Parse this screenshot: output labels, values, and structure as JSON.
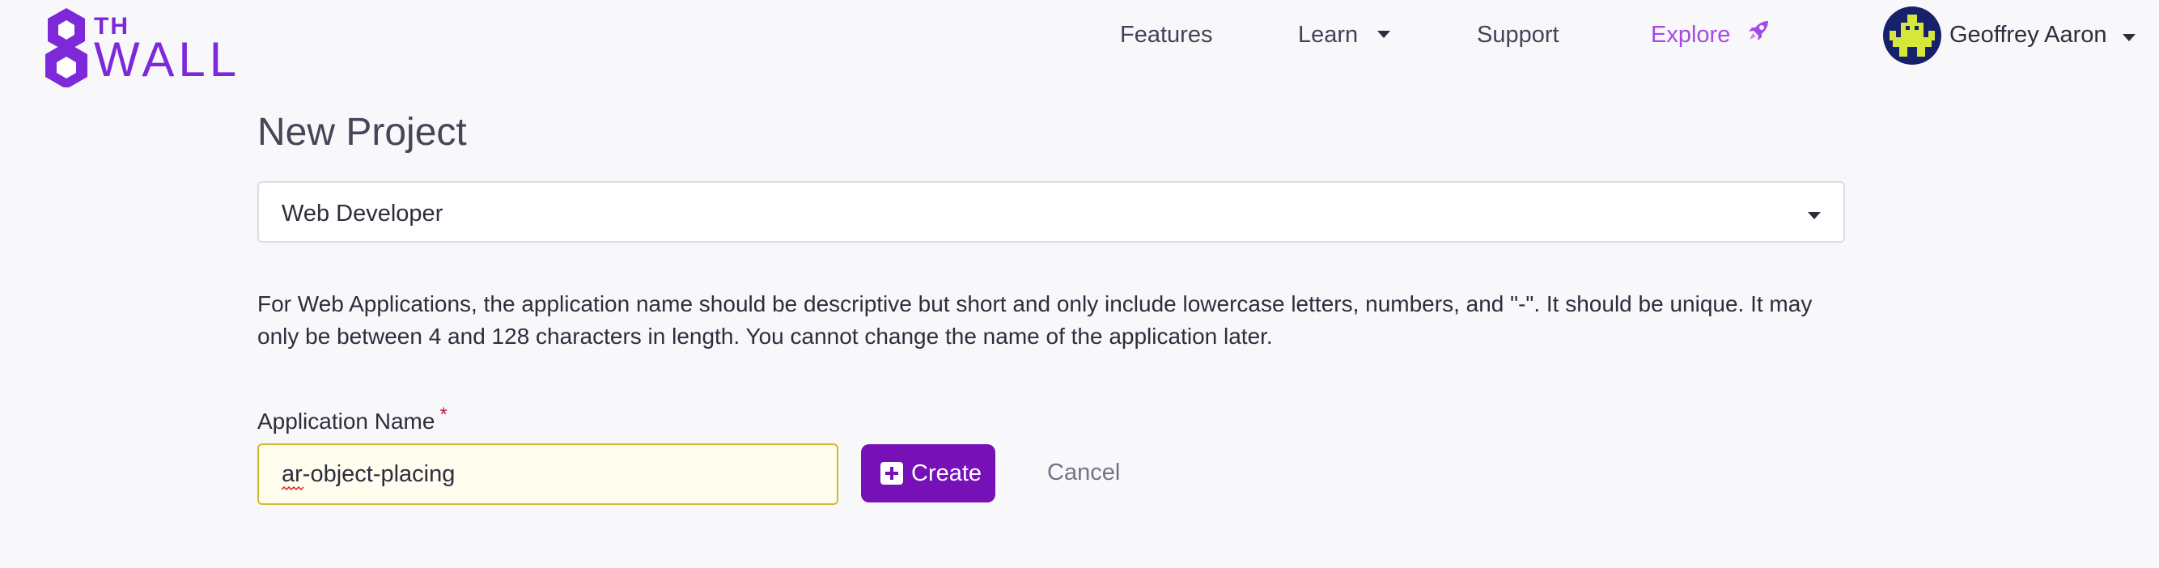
{
  "header": {
    "logo": {
      "th": "TH",
      "wall": "WALL"
    },
    "nav": {
      "features": "Features",
      "learn": "Learn",
      "support": "Support",
      "explore": "Explore"
    },
    "user": {
      "name": "Geoffrey Aaron"
    }
  },
  "main": {
    "title": "New Project",
    "project_type": {
      "selected": "Web Developer"
    },
    "description": "For Web Applications, the application name should be descriptive but short and only include lowercase letters, numbers, and \"-\". It should be unique. It may only be between 4 and 128 characters in length. You cannot change the name of the application later.",
    "form": {
      "label": "Application Name",
      "required_mark": "*",
      "name_value": "ar-object-placing",
      "create_label": "Create",
      "cancel_label": "Cancel"
    }
  },
  "colors": {
    "brand": "#7d29d9",
    "explore": "#a34be3",
    "primary_button": "#7611b7",
    "input_highlight_border": "#d4b82c",
    "input_highlight_bg": "#fefdee",
    "required": "#c4123f"
  },
  "icons": {
    "logo": "8th-wall-logo-icon",
    "learn": "chevron-down-icon",
    "explore": "rocket-icon",
    "user": "avatar-icon",
    "create": "plus-square-icon"
  }
}
